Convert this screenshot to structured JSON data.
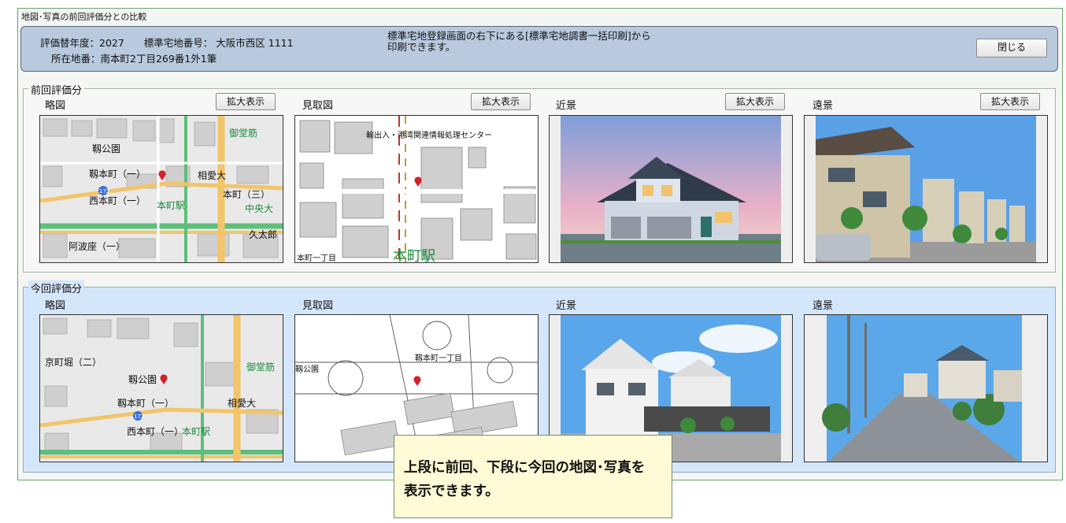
{
  "window": {
    "title": "地図･写真の前回評価分との比較"
  },
  "info": {
    "line1": "評価替年度：2027　　標準宅地番号： 大阪市西区 1111",
    "line2": "所在地番：南本町2丁目269番1外1筆",
    "note_line1": "標準宅地登録画面の右下にある[標準宅地調書一括印刷]から",
    "note_line2": "印刷できます。",
    "close_label": "閉じる"
  },
  "previous": {
    "legend": "前回評価分",
    "zoom_label": "拡大表示",
    "panes": [
      "略図",
      "見取図",
      "近景",
      "遠景"
    ],
    "map_labels": [
      "靱公園",
      "靱本町（一）",
      "西本町（一）",
      "本町駅",
      "相愛大",
      "阿波座（一）",
      "久太郎",
      "本町（三）",
      "中央大",
      "御堂筋",
      "172"
    ],
    "sketch_labels": [
      "輸出入・港湾関連情報処理センター",
      "本町駅",
      "本町一丁目"
    ]
  },
  "current": {
    "legend": "今回評価分",
    "panes": [
      "略図",
      "見取図",
      "近景",
      "遠景"
    ],
    "map_labels": [
      "靱公園",
      "京町堀（二）",
      "靱本町（一）",
      "西本町（一）",
      "本町駅",
      "相愛大",
      "御堂筋",
      "172"
    ],
    "sketch_labels": [
      "靱本町一丁目",
      "靱公園"
    ]
  },
  "callout": {
    "line1": "上段に前回、下段に今回の地図･写真を",
    "line2": "表示できます。"
  },
  "colors": {
    "section_prev_bg": "#f7f7f7",
    "section_curr_bg": "#d4e6fa",
    "info_bg": "#b9c9de",
    "callout_bg": "#fffbd6",
    "map_road": "#f2c56a",
    "map_green": "#5fbf7a"
  }
}
